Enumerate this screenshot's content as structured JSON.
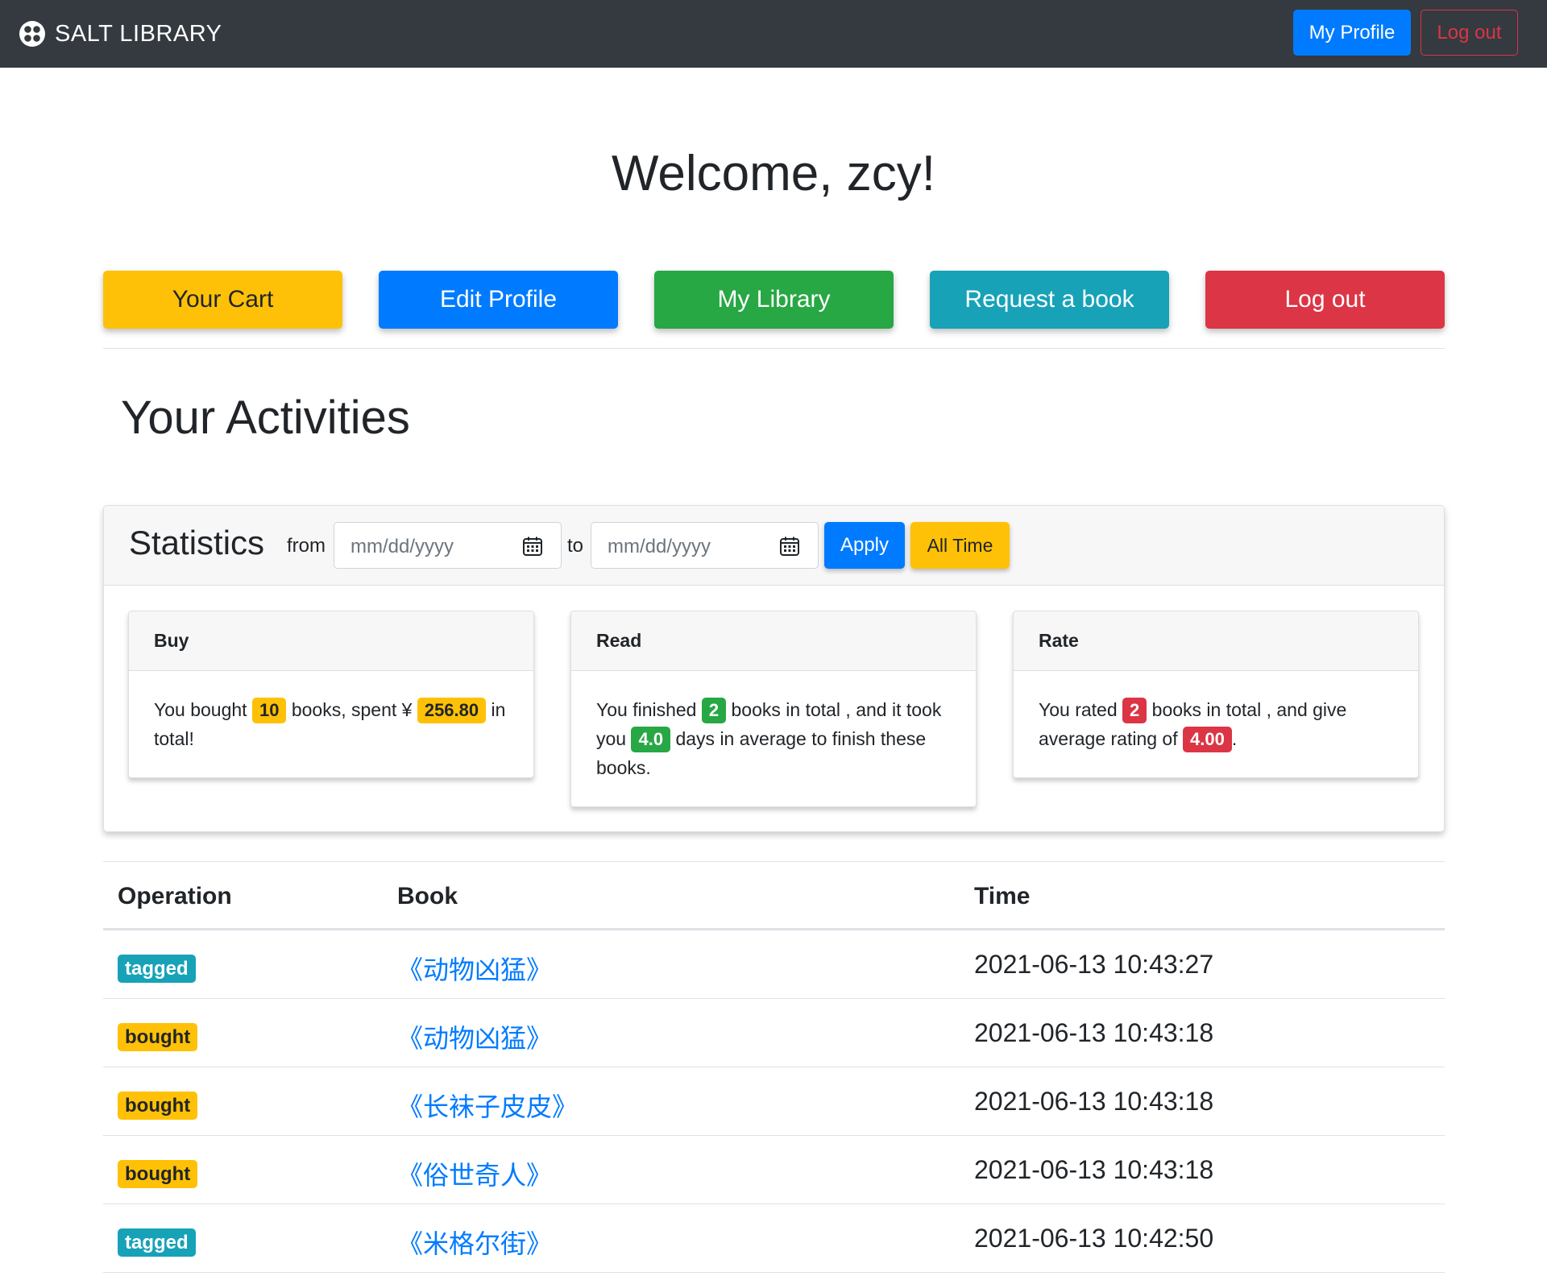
{
  "navbar": {
    "brand": "SALT LIBRARY",
    "my_profile": "My Profile",
    "log_out": "Log out"
  },
  "welcome": "Welcome, zcy!",
  "actions": {
    "your_cart": "Your Cart",
    "edit_profile": "Edit Profile",
    "my_library": "My Library",
    "request_book": "Request a book",
    "log_out": "Log out"
  },
  "activities_title": "Your Activities",
  "statistics": {
    "title": "Statistics",
    "from_label": "from",
    "to_label": "to",
    "from_placeholder": "mm/dd/yyyy",
    "to_placeholder": "mm/dd/yyyy",
    "apply": "Apply",
    "all_time": "All Time",
    "buy": {
      "header": "Buy",
      "t1": "You bought ",
      "count": "10",
      "t2": " books, spent ¥",
      "amount": "256.80",
      "t3": " in total!"
    },
    "read": {
      "header": "Read",
      "t1": "You finished ",
      "count": "2",
      "t2": " books in total , and it took you ",
      "days": "4.0",
      "t3": " days in average to finish these books."
    },
    "rate": {
      "header": "Rate",
      "t1": "You rated ",
      "count": "2",
      "t2": " books in total , and give average rating of ",
      "rating": "4.00",
      "t3": "."
    }
  },
  "table": {
    "headers": {
      "operation": "Operation",
      "book": "Book",
      "time": "Time"
    },
    "rows": [
      {
        "operation": "tagged",
        "book": "《动物凶猛》",
        "time": "2021-06-13 10:43:27"
      },
      {
        "operation": "bought",
        "book": "《动物凶猛》",
        "time": "2021-06-13 10:43:18"
      },
      {
        "operation": "bought",
        "book": "《长袜子皮皮》",
        "time": "2021-06-13 10:43:18"
      },
      {
        "operation": "bought",
        "book": "《俗世奇人》",
        "time": "2021-06-13 10:43:18"
      },
      {
        "operation": "tagged",
        "book": "《米格尔街》",
        "time": "2021-06-13 10:42:50"
      }
    ]
  },
  "colors": {
    "navbar": "#343a40",
    "primary": "#007bff",
    "warning": "#ffc107",
    "success": "#28a745",
    "info": "#17a2b8",
    "danger": "#dc3545"
  },
  "icons": [
    "logo-icon",
    "calendar-icon"
  ]
}
